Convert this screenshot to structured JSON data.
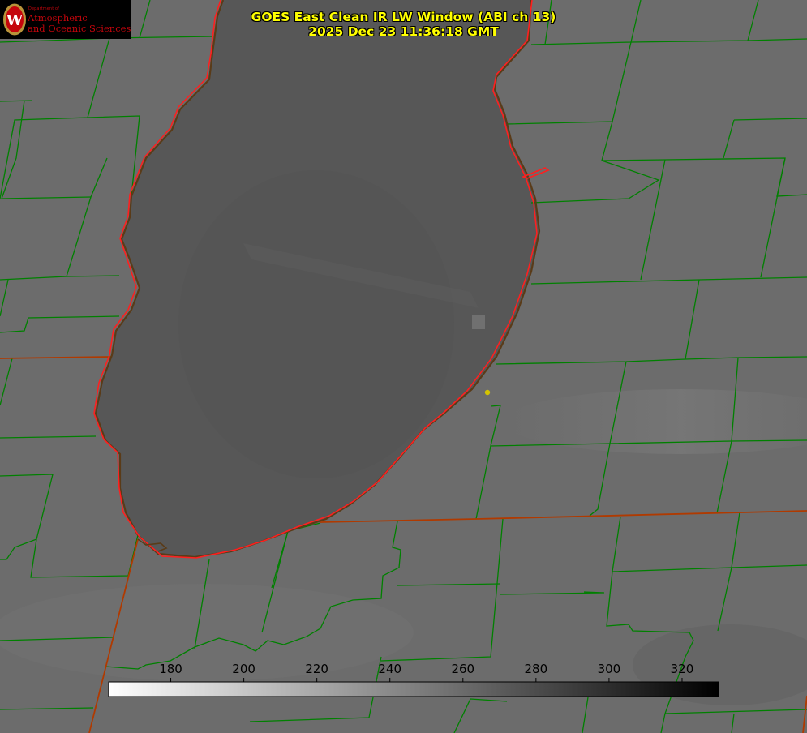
{
  "header": {
    "title": "GOES East Clean IR LW Window (ABI ch 13)",
    "timestamp": "2025 Dec 23 11:36:18 GMT"
  },
  "logo": {
    "department": "Department of",
    "line1": "Atmospheric",
    "line2": "and Oceanic Sciences",
    "seal_letter": "W"
  },
  "colorbar": {
    "ticks": [
      "180",
      "200",
      "220",
      "240",
      "260",
      "280",
      "300",
      "320"
    ],
    "tick_values": [
      180,
      200,
      220,
      240,
      260,
      280,
      300,
      320
    ],
    "range": [
      163,
      330
    ],
    "gradient_start": "#ffffff",
    "gradient_end": "#000000"
  },
  "colors": {
    "land": "#6e6e6e",
    "lake": "#565656",
    "county_lines": "#008000",
    "state_lines": "#b03a00",
    "shoreline_highres": "#ff1f1f",
    "title": "#ffff00",
    "marker": "#d4c400"
  }
}
